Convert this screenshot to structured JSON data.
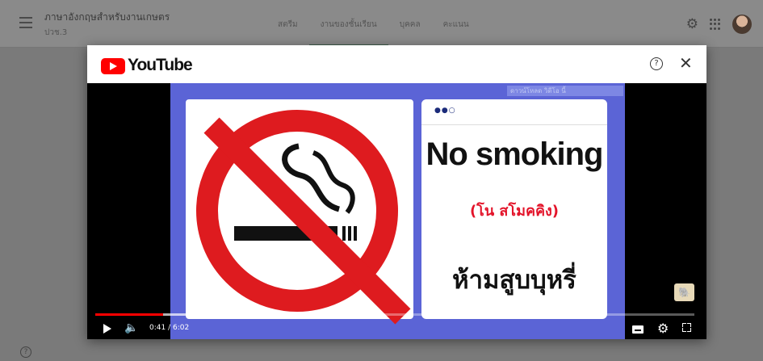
{
  "classroom": {
    "title": "ภาษาอังกฤษสำหรับงานเกษตร",
    "subtitle": "ปวช.3",
    "tabs": [
      {
        "label": "สตรีม"
      },
      {
        "label": "งานของชั้นเรียน",
        "active": true
      },
      {
        "label": "บุคคล"
      },
      {
        "label": "คะแนน"
      }
    ]
  },
  "modal": {
    "brand": "YouTube",
    "help_icon": "?",
    "close_icon": "✕"
  },
  "video": {
    "promo_label": "ดาวน์โหลด วิดีโอ นี้",
    "slide": {
      "dots": "●●○",
      "english": "No smoking",
      "pronunciation": "(โน สโมคคิง)",
      "thai": "ห้ามสูบบุหรี่"
    },
    "time": "0:41 / 6:02",
    "played_fraction": 0.113,
    "loaded_fraction": 0.2
  },
  "bottom_help": "?",
  "colors": {
    "youtube_red": "#ff0000",
    "sign_red": "#de1b1f",
    "slide_blue": "#5b64d6",
    "thai_red": "#e3142a"
  }
}
